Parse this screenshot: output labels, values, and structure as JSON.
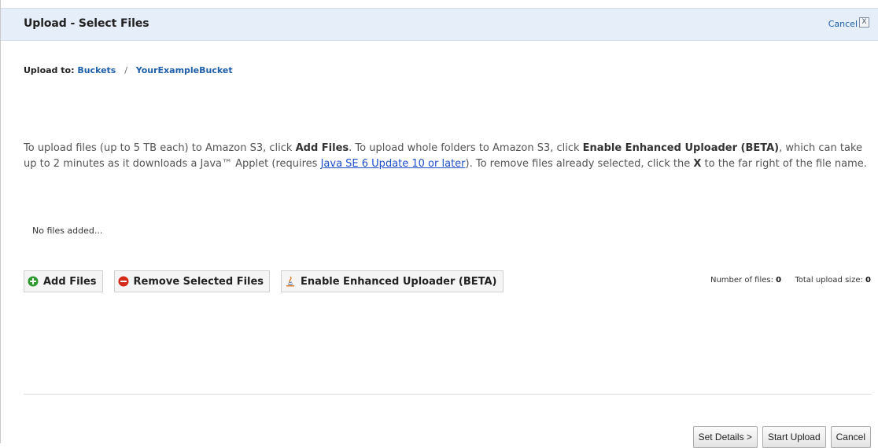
{
  "header": {
    "title": "Upload - Select Files",
    "cancel_label": "Cancel",
    "close_glyph": "X"
  },
  "upload_to": {
    "label": "Upload to:",
    "crumbs": [
      "Buckets",
      "YourExampleBucket"
    ],
    "separator": "/"
  },
  "instructions": {
    "part1": "To upload files (up to 5 TB each) to Amazon S3, click ",
    "add_files": "Add Files",
    "part2": ". To upload whole folders to Amazon S3, click ",
    "enable": "Enable Enhanced Uploader (BETA)",
    "part3": ", which can take up to 2 minutes as it downloads a Java™ Applet (requires ",
    "java_link": "Java SE 6 Update 10 or later",
    "part4": "). To remove files already selected, click the ",
    "x": "X",
    "part5": " to the far right of the file name."
  },
  "files": {
    "empty_text": "No files added..."
  },
  "toolbar": {
    "add_files": "Add Files",
    "remove_selected": "Remove Selected Files",
    "enable_enhanced": "Enable Enhanced Uploader (BETA)",
    "icons": [
      "plus-circle-icon",
      "minus-circle-icon",
      "java-icon"
    ]
  },
  "stats": {
    "num_files_label": "Number of files:",
    "num_files": "0",
    "total_size_label": "Total upload size:",
    "total_size": "0"
  },
  "footer": {
    "set_details": "Set Details >",
    "start_upload": "Start Upload",
    "cancel": "Cancel"
  },
  "colors": {
    "header_bg": "#e6eef9",
    "link": "#1f5fa9",
    "add_icon": "#2e9a2e",
    "remove_icon": "#d42a1a"
  }
}
